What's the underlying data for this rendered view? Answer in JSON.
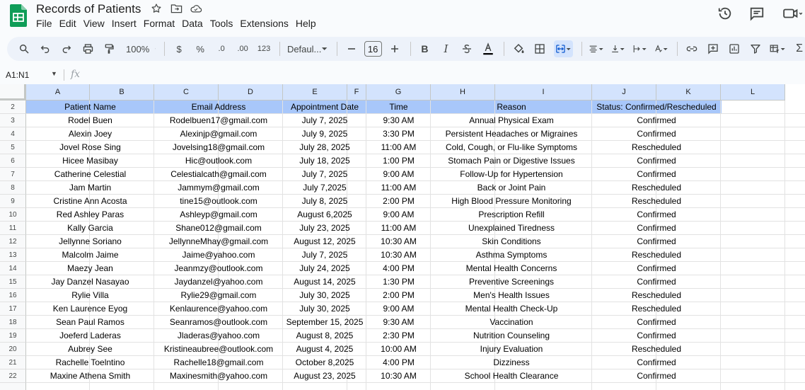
{
  "app": {
    "title": "Records of Patients",
    "menu": [
      "File",
      "Edit",
      "View",
      "Insert",
      "Format",
      "Data",
      "Tools",
      "Extensions",
      "Help"
    ]
  },
  "toolbar": {
    "zoom": "100%",
    "currency": "$",
    "percent": "%",
    "dec_decrease": ".0",
    "dec_increase": ".00",
    "format_123": "123",
    "font": "Defaul...",
    "font_size": "16"
  },
  "formula_bar": {
    "name_box": "A1:N1",
    "fx": "fx"
  },
  "sheet": {
    "columns": [
      {
        "letter": "A"
      },
      {
        "letter": "B"
      },
      {
        "letter": "C"
      },
      {
        "letter": "D"
      },
      {
        "letter": "E"
      },
      {
        "letter": "F"
      },
      {
        "letter": "G"
      },
      {
        "letter": "H"
      },
      {
        "letter": "I"
      },
      {
        "letter": "J"
      },
      {
        "letter": "K"
      },
      {
        "letter": "L"
      }
    ],
    "header_row_number": "2",
    "headers": {
      "name": "Patient Name",
      "email": "Email Address",
      "date": "Appointment Date",
      "time": "Time",
      "reason": "Reason",
      "status": "Status: Confirmed/Rescheduled"
    },
    "rows": [
      {
        "num": "3",
        "name": "Rodel Buen",
        "email": "Rodelbuen17@gmail.com",
        "date": "July 7, 2025",
        "time": "9:30 AM",
        "reason": "Annual Physical Exam",
        "status": "Confirmed"
      },
      {
        "num": "4",
        "name": "Alexin Joey",
        "email": "Alexinjp@gmail.com",
        "date": "July 9, 2025",
        "time": "3:30 PM",
        "reason": "Persistent Headaches or Migraines",
        "status": "Confirmed"
      },
      {
        "num": "5",
        "name": "Jovel Rose Sing",
        "email": "Jovelsing18@gmail.com",
        "date": "July 28, 2025",
        "time": "11:00 AM",
        "reason": "Cold, Cough, or Flu-like Symptoms",
        "status": "Rescheduled"
      },
      {
        "num": "6",
        "name": "Hicee Masibay",
        "email": "Hic@outlook.com",
        "date": "July 18, 2025",
        "time": "1:00 PM",
        "reason": "Stomach Pain or Digestive Issues",
        "status": "Confirmed"
      },
      {
        "num": "7",
        "name": "Catherine Celestial",
        "email": "Celestialcath@gmail.com",
        "date": "July 7, 2025",
        "time": "9:00 AM",
        "reason": "Follow-Up for Hypertension",
        "status": "Confirmed"
      },
      {
        "num": "8",
        "name": "Jam Martin",
        "email": "Jammym@gmail.com",
        "date": "July 7,2025",
        "time": "11:00 AM",
        "reason": "Back or Joint Pain",
        "status": "Rescheduled"
      },
      {
        "num": "9",
        "name": "Cristine Ann Acosta",
        "email": "tine15@outlook.com",
        "date": "July 8, 2025",
        "time": "2:00 PM",
        "reason": "High Blood Pressure Monitoring",
        "status": "Rescheduled"
      },
      {
        "num": "10",
        "name": "Red Ashley Paras",
        "email": "Ashleyp@gmail.com",
        "date": "August 6,2025",
        "time": "9:00 AM",
        "reason": "Prescription Refill",
        "status": "Confirmed"
      },
      {
        "num": "11",
        "name": "Kally Garcia",
        "email": "Shane012@gmail.com",
        "date": "July 23, 2025",
        "time": "11:00 AM",
        "reason": "Unexplained Tiredness",
        "status": "Confirmed"
      },
      {
        "num": "12",
        "name": "Jellynne Soriano",
        "email": "JellynneMhay@gmail.com",
        "date": "August 12, 2025",
        "time": "10:30 AM",
        "reason": "Skin Conditions",
        "status": "Confirmed"
      },
      {
        "num": "13",
        "name": "Malcolm Jaime",
        "email": "Jaime@yahoo.com",
        "date": "July 7, 2025",
        "time": "10:30 AM",
        "reason": "Asthma Symptoms",
        "status": "Rescheduled"
      },
      {
        "num": "14",
        "name": "Maezy Jean",
        "email": "Jeanmzy@outlook.com",
        "date": "July 24, 2025",
        "time": "4:00 PM",
        "reason": "Mental Health Concerns",
        "status": "Confirmed"
      },
      {
        "num": "15",
        "name": "Jay Danzel Nasayao",
        "email": "Jaydanzel@yahoo.com",
        "date": "August 14, 2025",
        "time": "1:30 PM",
        "reason": "Preventive Screenings",
        "status": "Confirmed"
      },
      {
        "num": "16",
        "name": "Rylie Villa",
        "email": "Rylie29@gmail.com",
        "date": "July 30, 2025",
        "time": "2:00 PM",
        "reason": "Men's Health Issues",
        "status": "Rescheduled"
      },
      {
        "num": "17",
        "name": "Ken Laurence Eyog",
        "email": "Kenlaurence@yahoo.com",
        "date": "July 30, 2025",
        "time": "9:00 AM",
        "reason": "Mental Health Check-Up",
        "status": "Rescheduled"
      },
      {
        "num": "18",
        "name": "Sean Paul Ramos",
        "email": "Seanramos@outlook.com",
        "date": "September 15, 2025",
        "time": "9:30 AM",
        "reason": "Vaccination",
        "status": "Confirmed"
      },
      {
        "num": "19",
        "name": "Joeferd Laderas",
        "email": "Jladeras@yahoo.com",
        "date": "August 8, 2025",
        "time": "2:30 PM",
        "reason": "Nutrition Counseling",
        "status": "Confirmed"
      },
      {
        "num": "20",
        "name": "Aubrey See",
        "email": "Kristineaubree@outlook.com",
        "date": "August 4, 2025",
        "time": "10:00 AM",
        "reason": "Injury Evaluation",
        "status": "Rescheduled"
      },
      {
        "num": "21",
        "name": "Rachelle Toelntino",
        "email": "Rachelle18@gmail.com",
        "date": "October 8,2025",
        "time": "4:00 PM",
        "reason": "Dizziness",
        "status": "Confirmed"
      },
      {
        "num": "22",
        "name": "Maxine Athena Smith",
        "email": "Maxinesmith@yahoo.com",
        "date": "August 23, 2025",
        "time": "10:30 AM",
        "reason": "School Health Clearance",
        "status": "Confirmed"
      }
    ]
  }
}
